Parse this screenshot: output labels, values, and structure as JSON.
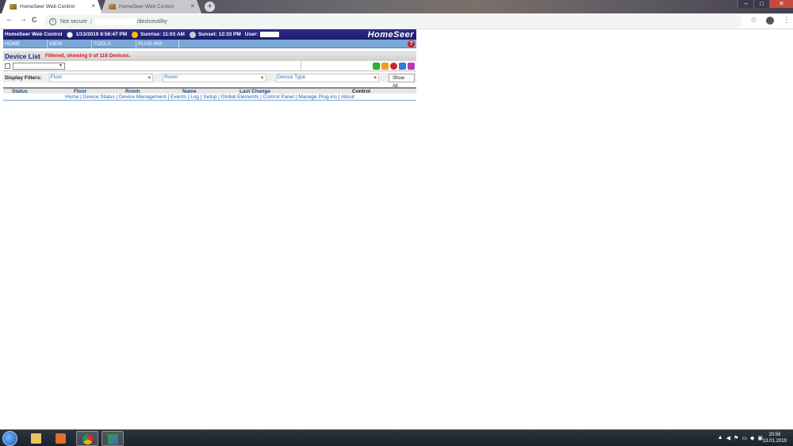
{
  "browser": {
    "tabs": [
      {
        "title": "HomeSeer Web Control",
        "active": true
      },
      {
        "title": "HomeSeer Web Control",
        "active": false
      }
    ],
    "new_tab": "+",
    "security": "Not secure",
    "separator": "|",
    "url_path": "/deviceutility",
    "back": "←",
    "forward": "→",
    "reload": "C",
    "star": "☆",
    "menu": "⋮",
    "window_controls": {
      "minimize": "–",
      "maximize": "□",
      "close": "✕"
    }
  },
  "homeseer": {
    "title": "HomeSeer Web Control",
    "datetime": "1/13/2019 8:56:47 PM",
    "sunrise": "Sunrise: 11:03 AM",
    "sunset": "Sunset: 12:33 PM",
    "user_label": "User:",
    "logo": "HomeSeer",
    "menu": [
      "HOME",
      "VIEW",
      "TOOLS",
      "PLUG-INS"
    ],
    "help": "?",
    "device_list_title": "Device List",
    "filter_message": "Filtered, showing 0 of 116 Devices.",
    "display_filters_label": "Display Filters:",
    "filters": [
      {
        "label": "Floor"
      },
      {
        "label": "Room"
      },
      {
        "label": "Device Type"
      }
    ],
    "show_all": "Show All",
    "columns": [
      "Status",
      "Floor",
      "Room",
      "Name",
      "Last Change",
      "Control"
    ],
    "footer_links": "Home | Device Status | Device Management | Events | Log | Setup | Global Elements | Control Panel | Manage Plug-ins | About",
    "action_button_colors": [
      "#2fb02f",
      "#e8a21c",
      "#d42424",
      "#3a7ad8",
      "#b43fb4"
    ]
  },
  "taskbar": {
    "time": "20:56",
    "date": "13.01.2019"
  }
}
